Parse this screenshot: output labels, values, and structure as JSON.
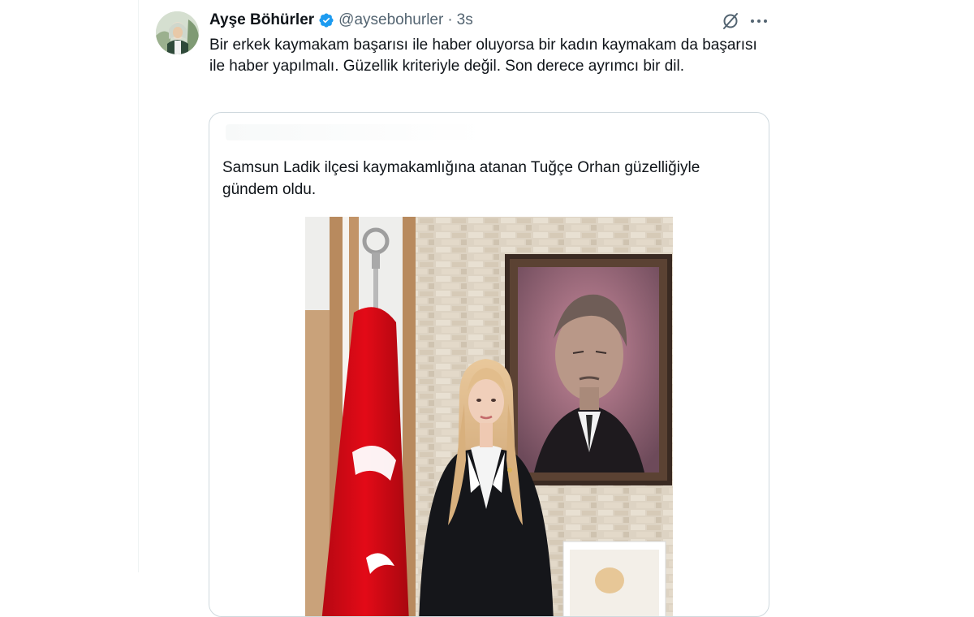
{
  "tweet": {
    "author_name": "Ayşe Böhürler",
    "author_handle": "@aysebohurler",
    "separator": "·",
    "timestamp": "3s",
    "text": "Bir erkek kaymakam başarısı ile haber oluyorsa bir kadın kaymakam da başarısı ile haber yapılmalı. Güzellik kriteriyle değil. Son derece ayrımcı bir dil.",
    "avatar_icon": "profile-photo",
    "badge_icon": "verified-badge-icon",
    "action_icons": [
      "grok-icon",
      "more-icon"
    ]
  },
  "quote": {
    "text": "Samsun Ladik ilçesi kaymakamlığına atanan Tuğçe Orhan güzelliğiyle gündem oldu.",
    "media_icon": "office-portrait-photo"
  },
  "colors": {
    "accent": "#1d9bf0",
    "text_primary": "#0f1419",
    "text_secondary": "#536471",
    "border": "#cfd9de",
    "flag_red": "#e30a17"
  }
}
